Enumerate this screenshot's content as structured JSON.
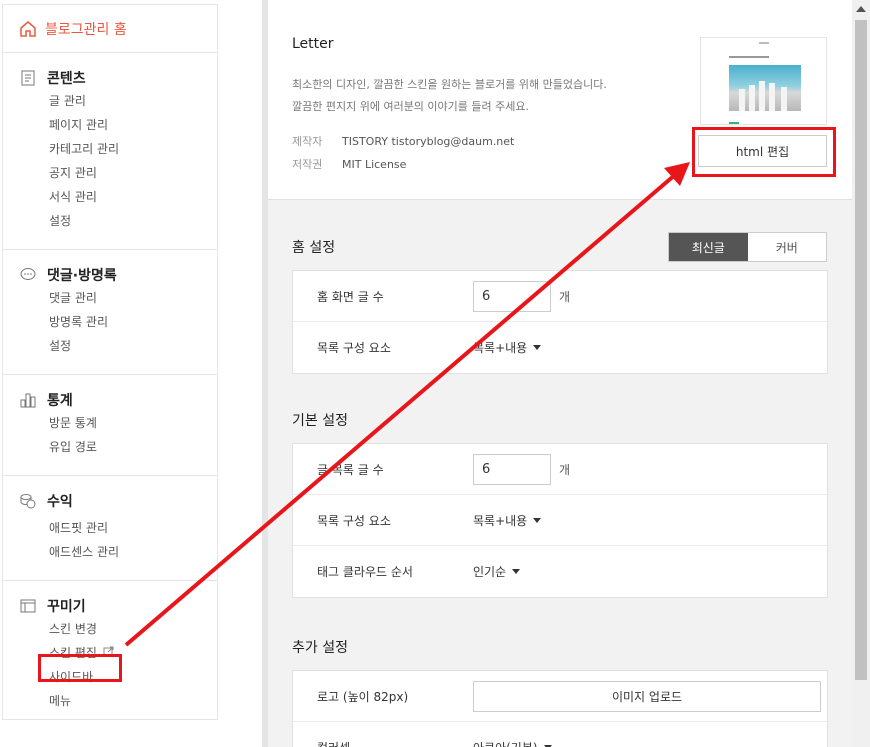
{
  "sidebar": {
    "home_label": "블로그관리 홈",
    "groups": [
      {
        "title": "콘텐츠",
        "icon": "document-icon",
        "items": [
          "글 관리",
          "페이지 관리",
          "카테고리 관리",
          "공지 관리",
          "서식 관리",
          "설정"
        ]
      },
      {
        "title": "댓글·방명록",
        "icon": "speech-bubble-icon",
        "items": [
          "댓글 관리",
          "방명록 관리",
          "설정"
        ]
      },
      {
        "title": "통계",
        "icon": "bar-chart-icon",
        "items": [
          "방문 통계",
          "유입 경로"
        ]
      },
      {
        "title": "수익",
        "icon": "coins-icon",
        "items": [
          "애드핏 관리",
          "애드센스 관리"
        ]
      },
      {
        "title": "꾸미기",
        "icon": "layout-icon",
        "items": [
          "스킨 변경",
          "스킨 편집",
          "사이드바",
          "메뉴"
        ]
      }
    ]
  },
  "skin": {
    "name": "Letter",
    "desc_line1": "최소한의 디자인, 깔끔한 스킨을 원하는 블로거를 위해 만들었습니다.",
    "desc_line2": "깔끔한 편지지 위에 여러분의 이야기를 들려 주세요.",
    "author_key": "제작자",
    "author_value": "TISTORY  tistoryblog@daum.net",
    "license_key": "저작권",
    "license_value": "MIT License",
    "html_edit_label": "html 편집"
  },
  "home_settings": {
    "title": "홈 설정",
    "toggle_latest": "최신글",
    "toggle_cover": "커버",
    "rows": [
      {
        "label": "홈 화면 글 수",
        "value": "6",
        "unit": "개"
      },
      {
        "label": "목록 구성 요소",
        "select": "목록+내용"
      }
    ]
  },
  "basic_settings": {
    "title": "기본 설정",
    "rows": [
      {
        "label": "글 목록 글 수",
        "value": "6",
        "unit": "개"
      },
      {
        "label": "목록 구성 요소",
        "select": "목록+내용"
      },
      {
        "label": "태그 클라우드 순서",
        "select": "인기순"
      }
    ]
  },
  "extra_settings": {
    "title": "추가 설정",
    "rows": [
      {
        "label": "로고 (높이 82px)",
        "button": "이미지 업로드"
      },
      {
        "label": "컬러셋",
        "select": "아쿠아(기본)"
      }
    ]
  },
  "colors": {
    "accent": "#f0563f",
    "annotation": "#e8161b",
    "toggle_active": "#555555"
  }
}
